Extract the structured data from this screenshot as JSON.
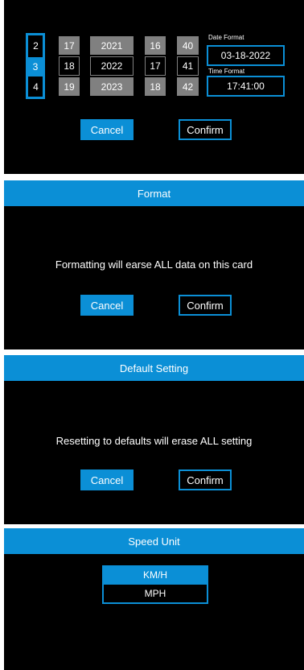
{
  "datetime": {
    "columns": [
      {
        "name": "month",
        "values": [
          "2",
          "3",
          "4"
        ],
        "selected_index": 1
      },
      {
        "name": "day",
        "values": [
          "17",
          "18",
          "19"
        ],
        "selected_index": 1
      },
      {
        "name": "year",
        "values": [
          "2021",
          "2022",
          "2023"
        ],
        "selected_index": 1
      },
      {
        "name": "hour",
        "values": [
          "16",
          "17",
          "18"
        ],
        "selected_index": 1
      },
      {
        "name": "minute",
        "values": [
          "40",
          "41",
          "42"
        ],
        "selected_index": 1
      }
    ],
    "date_format_label": "Date Format",
    "date_value": "03-18-2022",
    "time_format_label": "Time Format",
    "time_value": "17:41:00",
    "cancel_label": "Cancel",
    "confirm_label": "Confirm"
  },
  "format_dialog": {
    "title": "Format",
    "message": "Formatting will earse ALL data on this card",
    "cancel_label": "Cancel",
    "confirm_label": "Confirm"
  },
  "default_dialog": {
    "title": "Default Setting",
    "message": "Resetting to defaults will erase ALL setting",
    "cancel_label": "Cancel",
    "confirm_label": "Confirm"
  },
  "speed_unit": {
    "title": "Speed Unit",
    "options": [
      "KM/H",
      "MPH"
    ],
    "selected": "KM/H"
  },
  "colors": {
    "accent": "#0b8fd6",
    "background": "#000000",
    "inactive_cell": "#808080"
  }
}
